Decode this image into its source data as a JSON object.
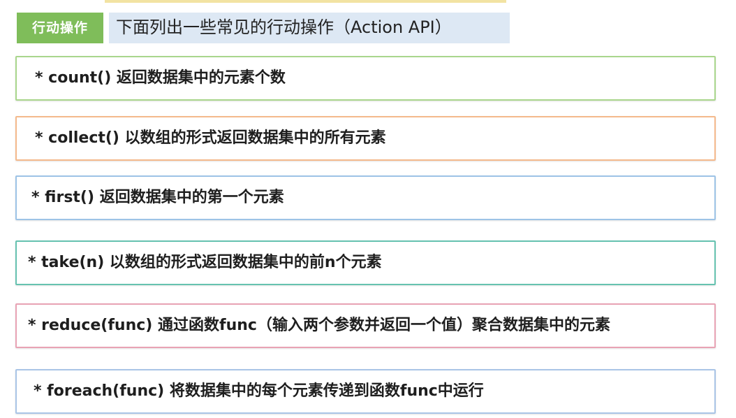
{
  "header": {
    "tag_label": "行动操作",
    "description": "下面列出一些常见的行动操作（Action API）"
  },
  "actions": [
    {
      "text": "* count() 返回数据集中的元素个数",
      "border_color": "#a9d68c"
    },
    {
      "text": "* collect() 以数组的形式返回数据集中的所有元素",
      "border_color": "#f4b98c"
    },
    {
      "text": "* first() 返回数据集中的第一个元素",
      "border_color": "#9dc3e6"
    },
    {
      "text": "* take(n) 以数组的形式返回数据集中的前n个元素",
      "border_color": "#66c2b0"
    },
    {
      "text": "* reduce(func) 通过函数func（输入两个参数并返回一个值）聚合数据集中的元素",
      "border_color": "#e8a3b4"
    },
    {
      "text": "* foreach(func) 将数据集中的每个元素传递到函数func中运行",
      "border_color": "#a9c4e6"
    }
  ]
}
